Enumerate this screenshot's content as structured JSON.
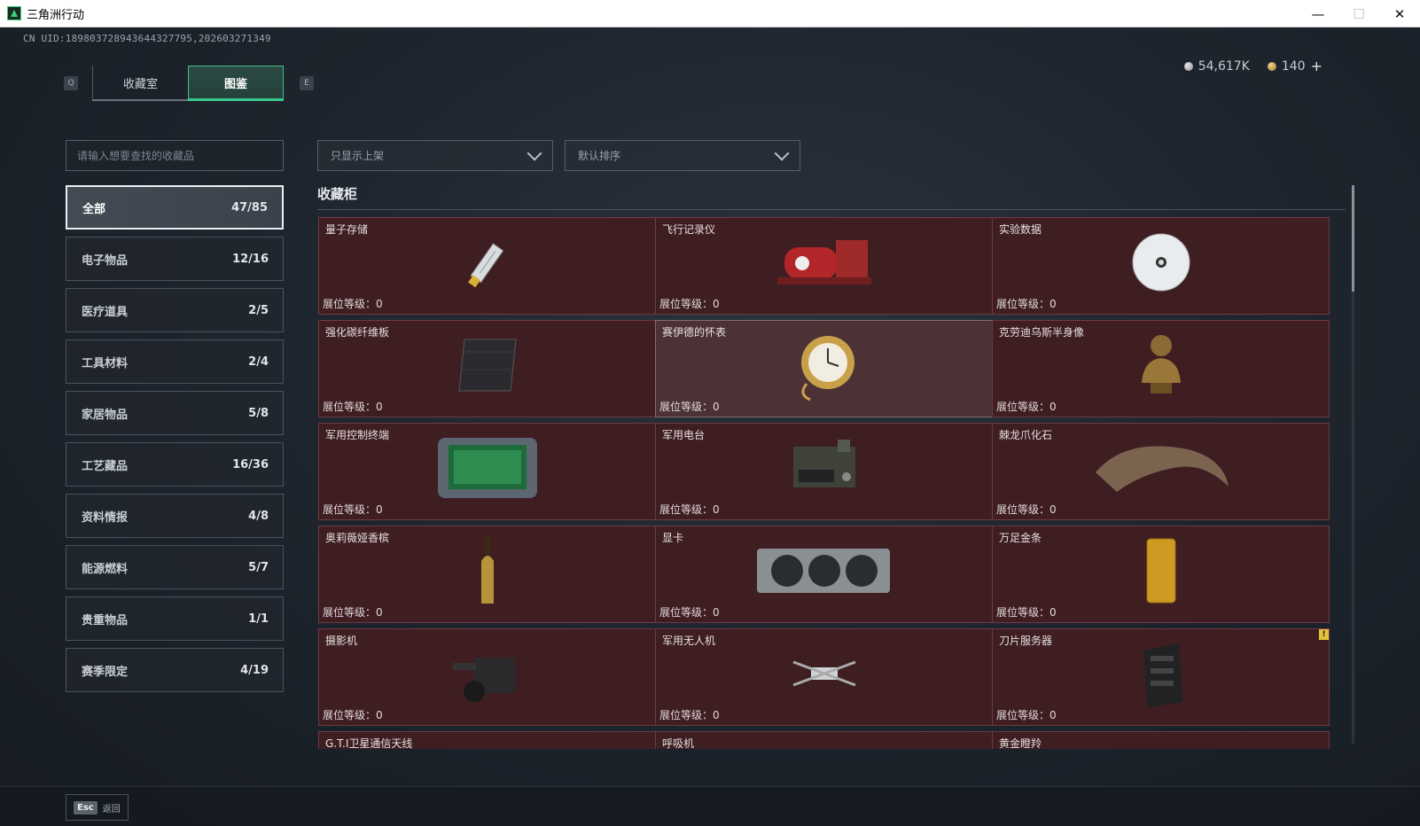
{
  "window": {
    "title": "三角洲行动",
    "controls": {
      "minimize": "—",
      "maximize": "☐",
      "close": "✕"
    }
  },
  "header": {
    "uid": "CN UID:1898037289436443277​95,202603271349",
    "tabs": [
      {
        "label": "收藏室",
        "active": false
      },
      {
        "label": "图鉴",
        "active": true
      }
    ],
    "key_left": "Q",
    "key_right": "E",
    "currency": [
      {
        "icon": "silver-coin-icon",
        "value": "54,617K"
      },
      {
        "icon": "gold-coin-icon",
        "value": "140"
      }
    ],
    "add_label": "+"
  },
  "search": {
    "placeholder": "请输入想要查找的收藏品"
  },
  "filters": {
    "shelf_filter": "只显示上架",
    "sort": "默认排序"
  },
  "categories": [
    {
      "label": "全部",
      "count": "47/85",
      "active": true
    },
    {
      "label": "电子物品",
      "count": "12/16"
    },
    {
      "label": "医疗道具",
      "count": "2/5"
    },
    {
      "label": "工具材料",
      "count": "2/4"
    },
    {
      "label": "家居物品",
      "count": "5/8"
    },
    {
      "label": "工艺藏品",
      "count": "16/36"
    },
    {
      "label": "资料情报",
      "count": "4/8"
    },
    {
      "label": "能源燃料",
      "count": "5/7"
    },
    {
      "label": "贵重物品",
      "count": "1/1"
    },
    {
      "label": "赛季限定",
      "count": "4/19"
    }
  ],
  "section": {
    "title": "收藏柜"
  },
  "level_label": "展位等级：",
  "items": [
    {
      "name": "量子存储",
      "level": "0",
      "icon": "usb-drive-icon"
    },
    {
      "name": "飞行记录仪",
      "level": "0",
      "icon": "flight-recorder-icon"
    },
    {
      "name": "实验数据",
      "level": "0",
      "icon": "disc-icon"
    },
    {
      "name": "强化碳纤维板",
      "level": "0",
      "icon": "carbon-plate-icon"
    },
    {
      "name": "赛伊德的怀表",
      "level": "0",
      "icon": "pocket-watch-icon"
    },
    {
      "name": "克劳迪乌斯半身像",
      "level": "0",
      "icon": "bust-icon"
    },
    {
      "name": "军用控制终端",
      "level": "0",
      "icon": "terminal-icon"
    },
    {
      "name": "军用电台",
      "level": "0",
      "icon": "radio-icon"
    },
    {
      "name": "棘龙爪化石",
      "level": "0",
      "icon": "claw-fossil-icon"
    },
    {
      "name": "奥莉薇娅香槟",
      "level": "0",
      "icon": "champagne-icon"
    },
    {
      "name": "显卡",
      "level": "0",
      "icon": "gpu-icon"
    },
    {
      "name": "万足金条",
      "level": "0",
      "icon": "gold-bar-icon"
    },
    {
      "name": "摄影机",
      "level": "0",
      "icon": "camera-icon"
    },
    {
      "name": "军用无人机",
      "level": "0",
      "icon": "drone-icon"
    },
    {
      "name": "刀片服务器",
      "level": "0",
      "icon": "server-icon",
      "warning": "!"
    },
    {
      "name": "G.T.I卫星通信天线",
      "level": "",
      "icon": ""
    },
    {
      "name": "呼吸机",
      "level": "",
      "icon": ""
    },
    {
      "name": "黄金瞪羚",
      "level": "",
      "icon": ""
    }
  ],
  "footer": {
    "key": "Esc",
    "label": "返回"
  }
}
